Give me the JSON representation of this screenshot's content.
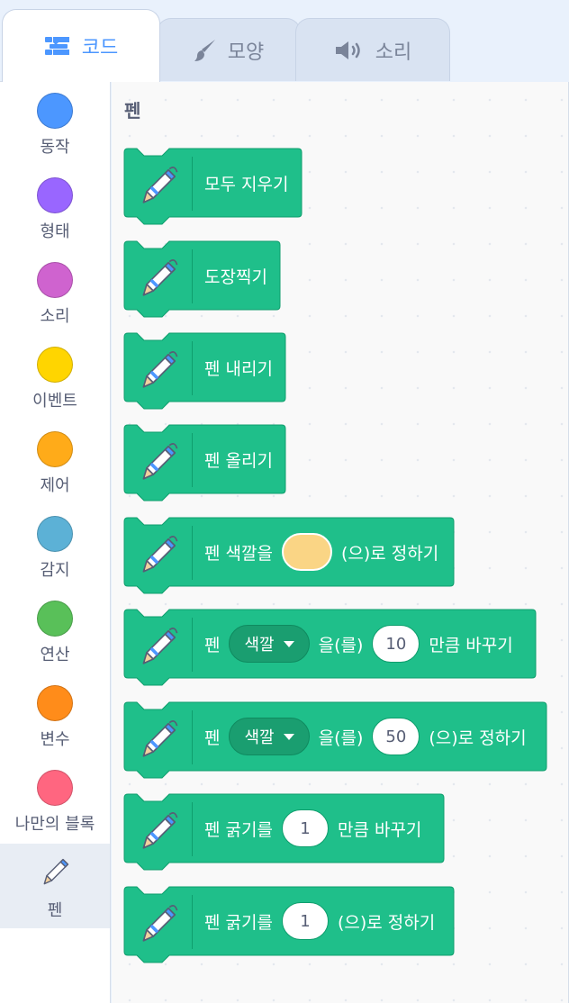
{
  "tabs": [
    {
      "label": "코드",
      "icon": "code-icon",
      "active": true
    },
    {
      "label": "모양",
      "icon": "brush-icon",
      "active": false
    },
    {
      "label": "소리",
      "icon": "speaker-icon",
      "active": false
    }
  ],
  "categories": [
    {
      "label": "동작",
      "color": "#4c97ff"
    },
    {
      "label": "형태",
      "color": "#9966ff"
    },
    {
      "label": "소리",
      "color": "#cf63cf"
    },
    {
      "label": "이벤트",
      "color": "#ffd500"
    },
    {
      "label": "제어",
      "color": "#ffab19"
    },
    {
      "label": "감지",
      "color": "#5cb1d6"
    },
    {
      "label": "연산",
      "color": "#59c059"
    },
    {
      "label": "변수",
      "color": "#ff8c1a"
    },
    {
      "label": "나만의 블록",
      "color": "#ff6680"
    },
    {
      "label": "펜",
      "icon": "pen-icon",
      "selected": true
    }
  ],
  "palette": {
    "title": "펜",
    "block_color": "#1fbf8a",
    "blocks": {
      "clear": {
        "text": "모두 지우기"
      },
      "stamp": {
        "text": "도장찍기"
      },
      "pen_down": {
        "text": "펜 내리기"
      },
      "pen_up": {
        "text": "펜 올리기"
      },
      "set_color": {
        "pre": "펜 색깔을",
        "post": "(으)로 정하기",
        "swatch_color": "#fad585"
      },
      "change_param": {
        "pre": "펜",
        "dropdown": "색깔",
        "mid": "을(를)",
        "value": "10",
        "post": "만큼 바꾸기"
      },
      "set_param": {
        "pre": "펜",
        "dropdown": "색깔",
        "mid": "을(를)",
        "value": "50",
        "post": "(으)로 정하기"
      },
      "change_size": {
        "pre": "펜 굵기를",
        "value": "1",
        "post": "만큼 바꾸기"
      },
      "set_size": {
        "pre": "펜 굵기를",
        "value": "1",
        "post": "(으)로 정하기"
      }
    }
  }
}
